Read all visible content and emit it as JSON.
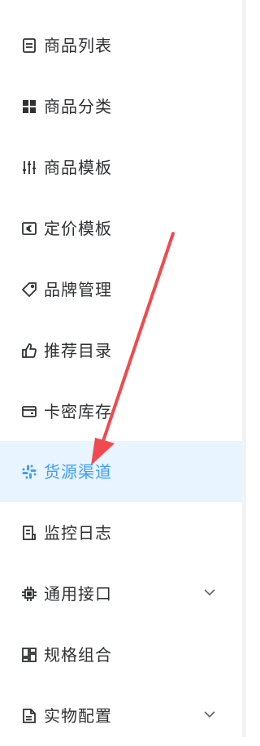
{
  "menu": {
    "items": [
      {
        "label": "商品列表",
        "icon": "list-icon"
      },
      {
        "label": "商品分类",
        "icon": "grid-icon"
      },
      {
        "label": "商品模板",
        "icon": "sliders-icon"
      },
      {
        "label": "定价模板",
        "icon": "euro-card-icon"
      },
      {
        "label": "品牌管理",
        "icon": "tag-icon"
      },
      {
        "label": "推荐目录",
        "icon": "thumb-up-icon"
      },
      {
        "label": "卡密库存",
        "icon": "card-icon"
      },
      {
        "label": "货源渠道",
        "icon": "slack-icon",
        "active": true
      },
      {
        "label": "监控日志",
        "icon": "log-icon"
      },
      {
        "label": "通用接口",
        "icon": "chip-icon",
        "expandable": true
      },
      {
        "label": "规格组合",
        "icon": "layout-icon"
      },
      {
        "label": "实物配置",
        "icon": "document-icon",
        "expandable": true
      }
    ]
  },
  "colors": {
    "active_bg": "#e8f4ff",
    "active_text": "#409eff",
    "text": "#303133",
    "annotation_arrow": "#f04a4f"
  }
}
